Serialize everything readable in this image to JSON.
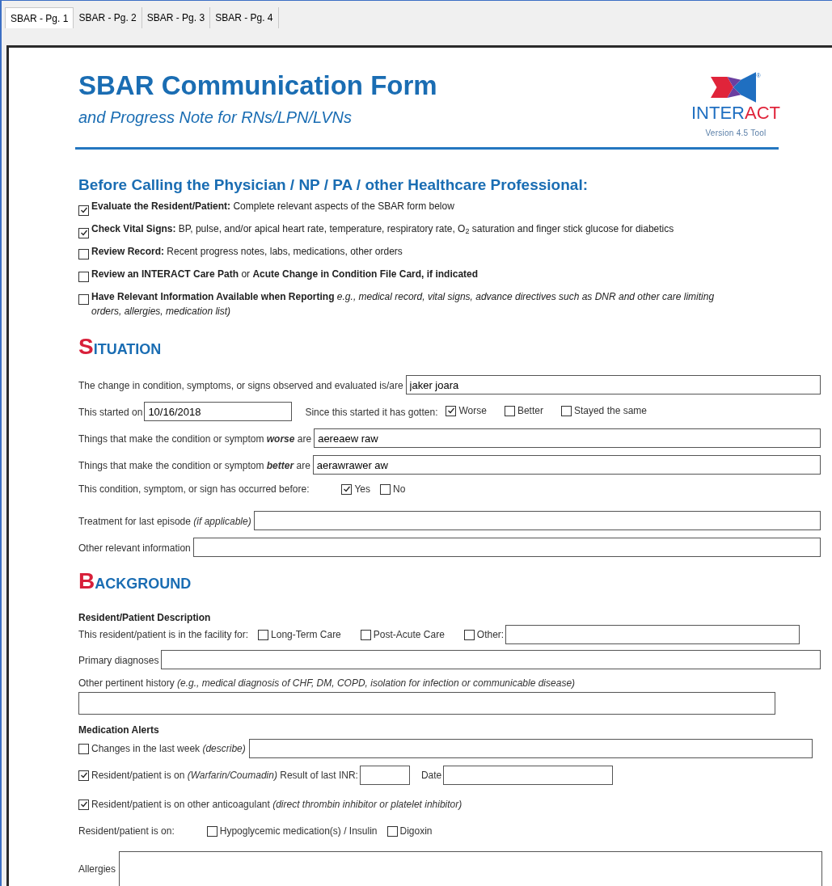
{
  "tabs": [
    {
      "label": "SBAR - Pg. 1",
      "selected": true
    },
    {
      "label": "SBAR - Pg. 2",
      "selected": false
    },
    {
      "label": "SBAR - Pg. 3",
      "selected": false
    },
    {
      "label": "SBAR - Pg. 4",
      "selected": false
    }
  ],
  "header": {
    "title": "SBAR Communication Form",
    "subtitle": "and Progress Note for RNs/LPN/LVNs",
    "logo": {
      "mark": "®",
      "name_left": "INTER",
      "name_right": "ACT",
      "version": "Version 4.5 Tool"
    }
  },
  "checklist": {
    "heading": "Before Calling the Physician / NP / PA / other Healthcare Professional:",
    "items": [
      {
        "text": "**Evaluate the Resident/Patient:** Complete relevant aspects of the SBAR form below",
        "checked": true
      },
      {
        "text": "**Check Vital Signs:** BP, pulse, and/or apical heart rate, temperature, respiratory rate, O$_{2}$ saturation and finger stick glucose for diabetics",
        "checked": true
      },
      {
        "text": "**Review Record:** Recent progress notes, labs, medications, other orders",
        "checked": false
      },
      {
        "text": "**Review an INTERACT Care Path** or **Acute Change in Condition File Card, if indicated**",
        "checked": false
      },
      {
        "text": "**Have Relevant Information Available when Reporting** *e.g., medical record, vital signs, advance directives such as DNR and other care limiting orders, allergies, medication list)*",
        "checked": false
      }
    ]
  },
  "sections": [
    {
      "initial": "S",
      "rest": "ITUATION",
      "rows": [
        {
          "kind": "field",
          "label": "The change in condition, symptoms, or signs observed and evaluated is/are",
          "value": "jaker joara"
        },
        {
          "kind": "date_trend",
          "label": "This started on",
          "value": "10/16/2018",
          "question": "Since this started it has gotten:",
          "options": [
            {
              "label": "Worse",
              "checked": true
            },
            {
              "label": "Better",
              "checked": false
            },
            {
              "label": "Stayed the same",
              "checked": false
            }
          ]
        },
        {
          "kind": "field",
          "label": "Things that make the condition or symptom **worse** are",
          "value": "aereaew raw"
        },
        {
          "kind": "field",
          "label": "Things that make the condition or symptom **better** are",
          "value": "aerawrawer aw"
        },
        {
          "kind": "options",
          "label": "This condition, symptom, or sign has occurred before:",
          "options": [
            {
              "label": "Yes",
              "checked": true
            },
            {
              "label": "No",
              "checked": false
            }
          ]
        },
        {
          "kind": "field",
          "label": "Treatment for last episode *(if applicable)*"
        },
        {
          "kind": "field",
          "label": "Other relevant information"
        }
      ]
    },
    {
      "initial": "B",
      "rest": "ACKGROUND",
      "rows": [
        {
          "kind": "subheading",
          "label": "Resident/Patient Description"
        },
        {
          "kind": "options_other",
          "label": "This resident/patient is in the facility for:",
          "options": [
            {
              "label": "Long-Term Care",
              "checked": false
            },
            {
              "label": "Post-Acute Care",
              "checked": false
            },
            {
              "label": "Other:",
              "checked": false
            }
          ]
        },
        {
          "kind": "field",
          "label": "Primary  diagnoses"
        },
        {
          "kind": "field_below",
          "label": "Other pertinent history *(e.g., medical diagnosis of CHF, DM, COPD, isolation for infection or communicable disease)*"
        },
        {
          "kind": "subheading",
          "label": "Medication Alerts"
        },
        {
          "kind": "check_field",
          "label": "Changes in the last week *(describe)*",
          "checked": false
        },
        {
          "kind": "check_inr",
          "label": "Resident/patient is on *(Warfarin/Coumadin)* Result of last INR:",
          "date_label": "Date",
          "checked": true
        },
        {
          "kind": "check_text",
          "label": "Resident/patient is on other anticoagulant *(direct thrombin inhibitor or platelet inhibitor)*",
          "checked": true
        },
        {
          "kind": "options",
          "label": "Resident/patient is on:",
          "options": [
            {
              "label": "Hypoglycemic medication(s) / Insulin",
              "checked": false
            },
            {
              "label": "Digoxin",
              "checked": false
            }
          ]
        },
        {
          "kind": "area",
          "label": "Allergies"
        }
      ]
    }
  ]
}
